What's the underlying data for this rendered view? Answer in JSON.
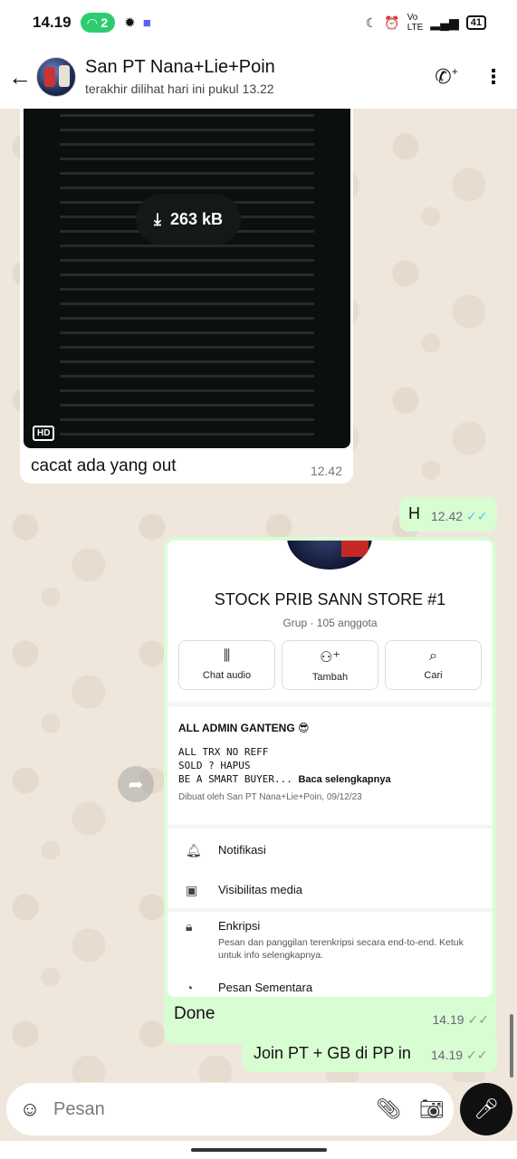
{
  "status_bar": {
    "time": "14.19",
    "hotspot_count": "2",
    "battery": "41"
  },
  "header": {
    "title": "San PT Nana+Lie+Poin",
    "subtitle": "terakhir dilihat hari ini pukul 13.22"
  },
  "messages": {
    "video": {
      "size": "263 kB",
      "quality_badge": "HD",
      "caption": "cacat ada yang out",
      "time": "12.42"
    },
    "out_h": {
      "text": "H",
      "time": "12.42"
    },
    "group_card": {
      "name": "STOCK PRIB SANN STORE #1",
      "meta": "Grup · 105 anggota",
      "actions": [
        {
          "label": "Chat audio",
          "icon": "audio-wave-icon"
        },
        {
          "label": "Tambah",
          "icon": "add-person-icon"
        },
        {
          "label": "Cari",
          "icon": "search-icon"
        }
      ],
      "desc_title": "ALL ADMIN GANTENG 😎",
      "desc_lines": "ALL TRX NO REFF\nSOLD ? HAPUS\nBE A SMART BUYER...",
      "read_more": "Baca selengkapnya",
      "created_by": "Dibuat oleh San PT Nana+Lie+Poin, 09/12/23",
      "notifications": "Notifikasi",
      "media_visibility": "Visibilitas media",
      "encryption": "Enkripsi",
      "encryption_sub": "Pesan dan panggilan terenkripsi secara end-to-end. Ketuk untuk info selengkapnya.",
      "temp_messages": "Pesan Sementara",
      "caption": "Done",
      "time": "14.19"
    },
    "out_join": {
      "text": "Join PT + GB di PP in",
      "time": "14.19"
    }
  },
  "input": {
    "placeholder": "Pesan"
  },
  "colors": {
    "outgoing": "#d9fdd3",
    "incoming": "#ffffff",
    "read_tick": "#53bdeb",
    "background": "#efe7dc"
  }
}
